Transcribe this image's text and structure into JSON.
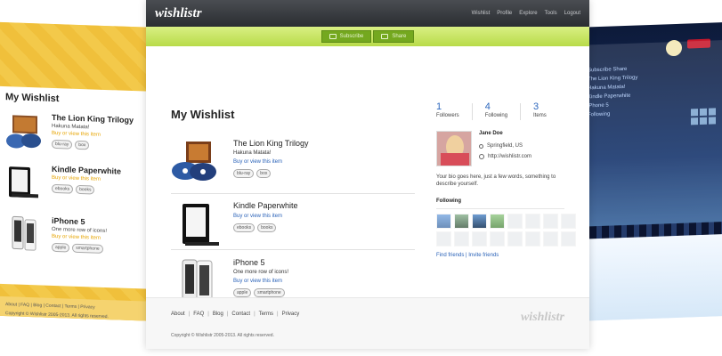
{
  "header": {
    "brand": "wishlistr",
    "nav": [
      "Wishlist",
      "Profile",
      "Explore",
      "Tools",
      "Logout"
    ]
  },
  "actions": {
    "subscribe": "Subscribe",
    "share": "Share"
  },
  "main": {
    "title": "My Wishlist",
    "items": [
      {
        "name": "The Lion King Trilogy",
        "subtitle": "Hakuna Matata!",
        "link": "Buy or view this item",
        "tags": [
          "blu-ray",
          "box"
        ]
      },
      {
        "name": "Kindle Paperwhite",
        "link": "Buy or view this item",
        "tags": [
          "ebooks",
          "books"
        ]
      },
      {
        "name": "iPhone 5",
        "subtitle": "One more row of icons!",
        "link": "Buy or view this item",
        "tags": [
          "apple",
          "smartphone"
        ]
      }
    ]
  },
  "sidebar": {
    "stats": [
      {
        "value": "1",
        "label": "Followers"
      },
      {
        "value": "4",
        "label": "Following"
      },
      {
        "value": "3",
        "label": "Items"
      }
    ],
    "profile_name": "Jane Doe",
    "location": "Springfield, US",
    "website": "http://wishlistr.com",
    "bio": "Your bio goes here, just a few words, something to describe yourself.",
    "following_title": "Following",
    "find_friends": "Find friends",
    "invite_friends": "Invite friends"
  },
  "footer": {
    "links": [
      "About",
      "FAQ",
      "Blog",
      "Contact",
      "Terms",
      "Privacy"
    ],
    "copyright": "Copyright © Wishlistr 2005-2013. All rights reserved.",
    "brand": "wishlistr"
  },
  "left_preview": {
    "title": "My Wishlist",
    "items": [
      {
        "name": "The Lion King Trilogy",
        "subtitle": "Hakuna Matata!",
        "link": "Buy or view this item",
        "tags": [
          "blu-ray",
          "box"
        ]
      },
      {
        "name": "Kindle Paperwhite",
        "link": "Buy or view this item",
        "tags": [
          "ebooks",
          "books"
        ]
      },
      {
        "name": "iPhone 5",
        "subtitle": "One more row of icons!",
        "link": "Buy or view this item",
        "tags": [
          "apple",
          "smartphone"
        ]
      }
    ],
    "footer_links": "About | FAQ | Blog | Contact | Terms | Privacy",
    "copyright": "Copyright © Wishlistr 2005-2013. All rights reserved."
  },
  "right_preview": {
    "subscribe": "Subscribe",
    "share": "Share",
    "lines": [
      "The Lion King Trilogy",
      "Hakuna Matata!",
      "Kindle Paperwhite",
      "iPhone 5",
      "Following"
    ]
  }
}
